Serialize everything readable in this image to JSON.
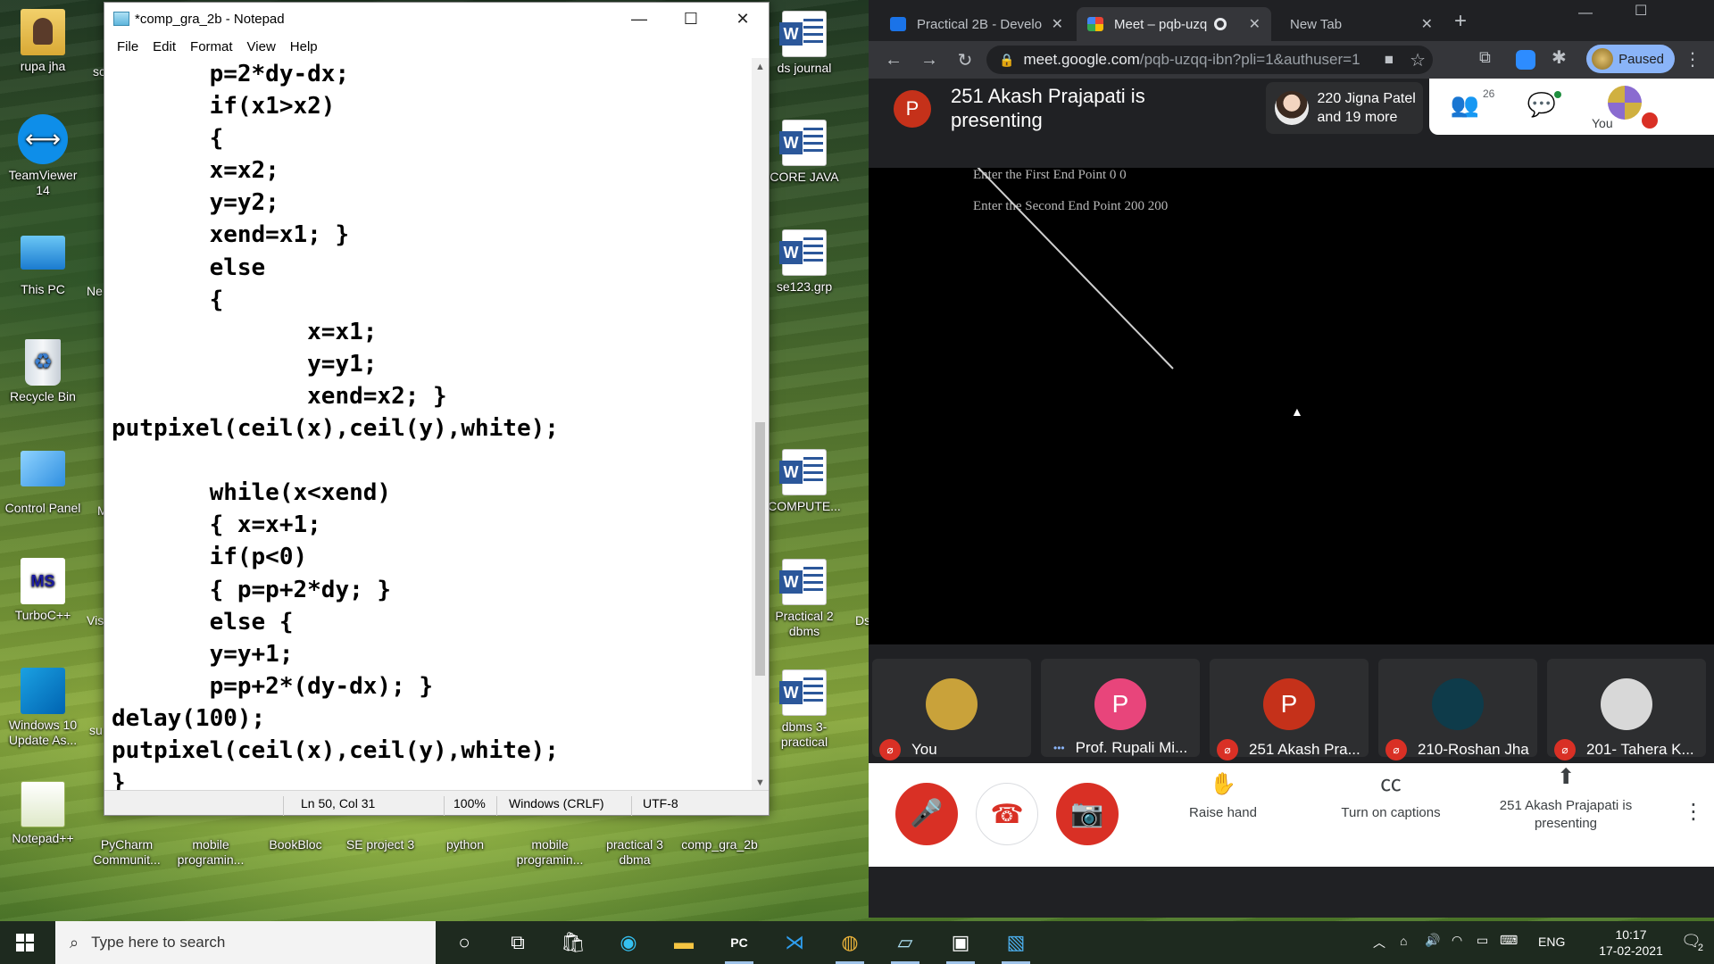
{
  "desktop": {
    "icons_left": [
      {
        "label": "rupa jha"
      },
      {
        "label": "TeamViewer 14"
      },
      {
        "label": "This PC"
      },
      {
        "label": "Recycle Bin"
      },
      {
        "label": "Control Panel"
      },
      {
        "label": "TurboC++"
      },
      {
        "label": "Windows 10 Update As..."
      },
      {
        "label": "Notepad++"
      }
    ],
    "partial_labels": [
      "sc",
      "Ne",
      "M",
      "Vis",
      "su",
      "Ds"
    ],
    "icons_mid": [
      {
        "label": "ds journal"
      },
      {
        "label": "CORE JAVA"
      },
      {
        "label": "se123.grp"
      },
      {
        "label": "COMPUTE..."
      },
      {
        "label": "Practical 2 dbms"
      },
      {
        "label": "dbms 3-practical"
      }
    ],
    "icons_bottom": [
      {
        "label": "PyCharm Communit..."
      },
      {
        "label": "mobile programin..."
      },
      {
        "label": "BookBloc"
      },
      {
        "label": "SE project 3"
      },
      {
        "label": "python"
      },
      {
        "label": "mobile programin..."
      },
      {
        "label": "practical 3 dbma"
      },
      {
        "label": "comp_gra_2b"
      }
    ]
  },
  "notepad": {
    "title": "*comp_gra_2b - Notepad",
    "menu": [
      "File",
      "Edit",
      "Format",
      "View",
      "Help"
    ],
    "lines": [
      "       p=2*dy-dx;",
      "       if(x1>x2)",
      "       {",
      "       x=x2;",
      "       y=y2;",
      "       xend=x1; }",
      "       else",
      "       {",
      "              x=x1;",
      "              y=y1;",
      "              xend=x2; }",
      "putpixel(ceil(x),ceil(y),white);",
      "",
      "       while(x<xend)",
      "       { x=x+1;",
      "       if(p<0)",
      "       { p=p+2*dy; }",
      "       else {",
      "       y=y+1;",
      "       p=p+2*(dy-dx); }",
      "delay(100);",
      "putpixel(ceil(x),ceil(y),white);",
      "}"
    ],
    "status": {
      "position": "Ln 50, Col 31",
      "zoom": "100%",
      "line_ending": "Windows (CRLF)",
      "encoding": "UTF-8"
    }
  },
  "browser": {
    "tabs": [
      {
        "label": "Practical 2B - Develo",
        "active": false
      },
      {
        "label": "Meet – pqb-uzq",
        "active": true
      },
      {
        "label": "New Tab",
        "active": false
      }
    ],
    "url_main": "meet.google.com",
    "url_rest": "/pqb-uzqq-ibn?pli=1&authuser=1",
    "profile_status": "Paused"
  },
  "meet": {
    "presenter_initial": "P",
    "presenting_text": "251 Akash Prajapati is presenting",
    "others_text": "220 Jigna Patel and 19 more",
    "people_count": "26",
    "self_label": "You",
    "screen_lines": [
      "Enter the First End Point 0 0",
      "Enter the Second End Point 200 200"
    ],
    "participants": [
      {
        "name": "You",
        "initial": "",
        "color": "#c9a23a",
        "muted": true
      },
      {
        "name": "Prof. Rupali Mi...",
        "initial": "P",
        "color": "#e8457b",
        "muted": false
      },
      {
        "name": "251 Akash Pra...",
        "initial": "P",
        "color": "#c5311a",
        "muted": true
      },
      {
        "name": "210-Roshan Jha",
        "initial": "",
        "color": "#0e3b4a",
        "muted": true
      },
      {
        "name": "201- Tahera K...",
        "initial": "",
        "color": "#d8d8d8",
        "muted": true
      }
    ],
    "controls": {
      "raise_hand": "Raise hand",
      "captions": "Turn on captions",
      "presenting": "251 Akash Prajapati is presenting"
    }
  },
  "taskbar": {
    "search_placeholder": "Type here to search",
    "language": "ENG",
    "time": "10:17",
    "date": "17-02-2021",
    "notification_count": "2"
  }
}
